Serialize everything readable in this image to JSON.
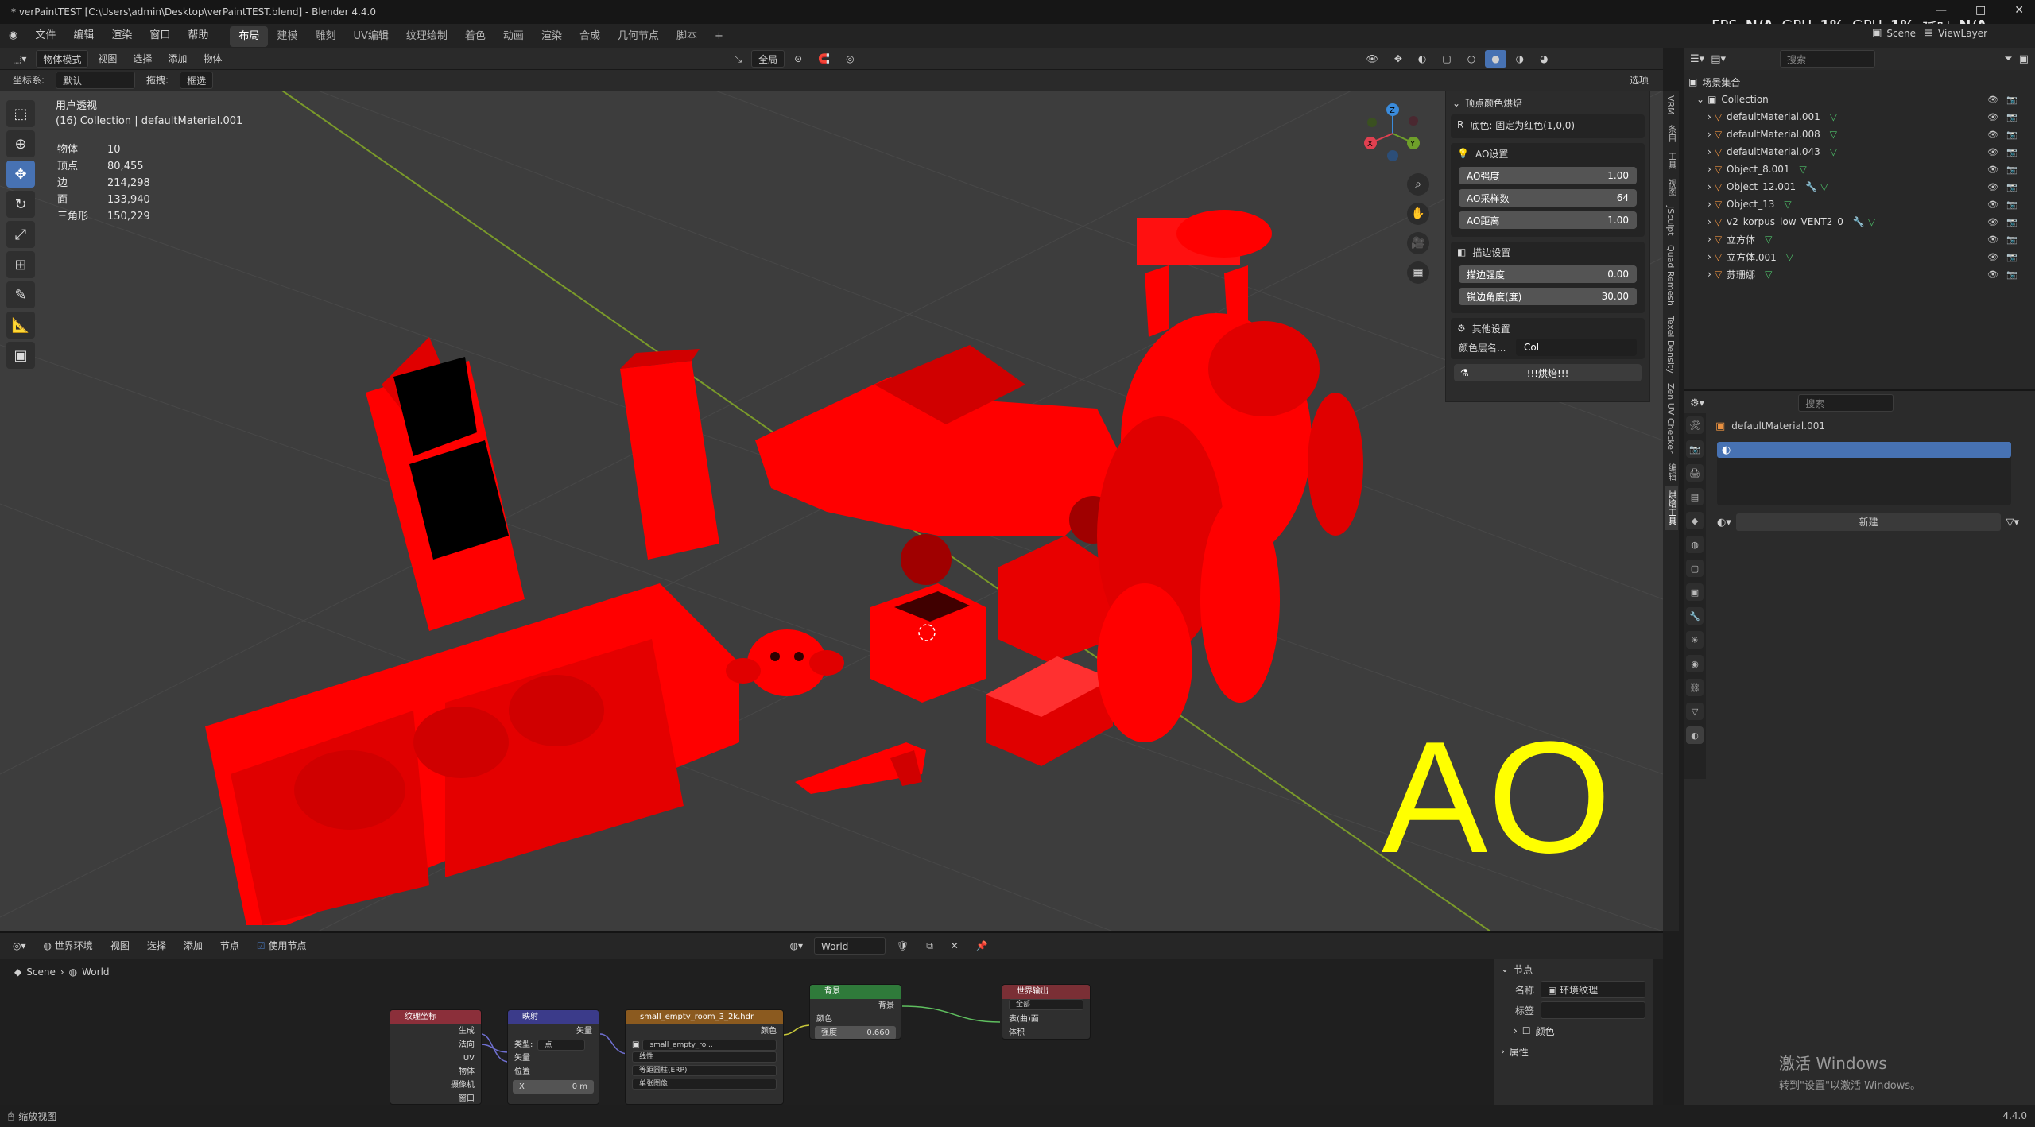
{
  "window": {
    "title": "* verPaintTEST [C:\\Users\\admin\\Desktop\\verPaintTEST.blend] - Blender 4.4.0",
    "perf": {
      "fps_label": "FPS",
      "fps_value": "N/A",
      "gpu_label": "GPU",
      "gpu_value": "1%",
      "gpu2_label": "GPU",
      "gpu2_value": "1%",
      "latency_label": "延时",
      "latency_value": "N/A"
    },
    "scene_label": "Scene",
    "viewlayer_label": "ViewLayer",
    "controls": [
      "—",
      "□",
      "✕"
    ]
  },
  "menubar": {
    "items": [
      "文件",
      "编辑",
      "渲染",
      "窗口",
      "帮助"
    ],
    "workspaces": [
      "布局",
      "建模",
      "雕刻",
      "UV编辑",
      "纹理绘制",
      "着色",
      "动画",
      "渲染",
      "合成",
      "几何节点",
      "脚本"
    ],
    "active_workspace": "布局"
  },
  "viewport_header": {
    "mode": "物体模式",
    "menus": [
      "视图",
      "选择",
      "添加",
      "物体"
    ],
    "transform": "全局",
    "coord_label": "坐标系:",
    "coord_value": "默认",
    "drag_label": "拖拽:",
    "drag_value": "框选",
    "options": "选项"
  },
  "viewport": {
    "view_name": "用户透视",
    "collection_info": "(16) Collection | defaultMaterial.001",
    "stats": [
      {
        "label": "物体",
        "value": "10"
      },
      {
        "label": "顶点",
        "value": "80,455"
      },
      {
        "label": "边",
        "value": "214,298"
      },
      {
        "label": "面",
        "value": "133,940"
      },
      {
        "label": "三角形",
        "value": "150,229"
      }
    ],
    "overlay_text": "AO",
    "overlay_color": "#ffff00",
    "axis_x": "X",
    "axis_y": "Y",
    "axis_z": "Z"
  },
  "npanel": {
    "header": "顶点颜色烘焙",
    "base_label": "底色: 固定为红色(1,0,0)",
    "ao_section": "AO设置",
    "ao_fields": [
      {
        "label": "AO强度",
        "value": "1.00"
      },
      {
        "label": "AO采样数",
        "value": "64"
      },
      {
        "label": "AO距离",
        "value": "1.00"
      }
    ],
    "edge_section": "描边设置",
    "edge_fields": [
      {
        "label": "描边强度",
        "value": "0.00"
      },
      {
        "label": "锐边角度(度)",
        "value": "30.00"
      }
    ],
    "other_section": "其他设置",
    "layer_label": "颜色层名...",
    "layer_value": "Col",
    "bake_button": "!!!烘焙!!!"
  },
  "side_tabs": [
    "VRM",
    "条目",
    "工具",
    "视图",
    "JSculpt",
    "Quad Remesh",
    "Texel Density",
    "Zen UV Checker",
    "编辑",
    "烘焙工具"
  ],
  "outliner": {
    "search_placeholder": "搜索",
    "root": "场景集合",
    "collection": "Collection",
    "objects": [
      "defaultMaterial.001",
      "defaultMaterial.008",
      "defaultMaterial.043",
      "Object_8.001",
      "Object_12.001",
      "Object_13",
      "v2_korpus_low_VENT2_0",
      "立方体",
      "立方体.001",
      "苏珊娜"
    ]
  },
  "properties": {
    "search_placeholder": "搜索",
    "object_name": "defaultMaterial.001",
    "new_button": "新建"
  },
  "node_editor": {
    "editor_type": "世界环境",
    "menus": [
      "视图",
      "选择",
      "添加",
      "节点"
    ],
    "use_nodes_label": "使用节点",
    "world_name": "World",
    "breadcrumb": [
      "Scene",
      "World"
    ],
    "nodes": {
      "texcoord": {
        "title": "纹理坐标",
        "outputs": [
          "生成",
          "法向",
          "UV",
          "物体",
          "摄像机",
          "窗口"
        ]
      },
      "mapping": {
        "title": "映射",
        "vector_out": "矢量",
        "type_label": "类型:",
        "type_value": "点",
        "inputs": [
          "矢量",
          "位置"
        ],
        "x_label": "X",
        "x_value": "0 m"
      },
      "envtex": {
        "title": "small_empty_room_3_2k.hdr",
        "color_out": "颜色",
        "image": "small_empty_ro...",
        "interp": "线性",
        "proj": "等距圆柱(ERP)",
        "src": "单张图像"
      },
      "background": {
        "title": "背景",
        "out": "背景",
        "color_in": "颜色",
        "strength_label": "强度",
        "strength_value": "0.660"
      },
      "output": {
        "title": "世界输出",
        "target": "全部",
        "surface": "表(曲)面",
        "volume": "体积"
      }
    },
    "side": {
      "node_section": "节点",
      "name_label": "名称",
      "name_value": "环境纹理",
      "label_label": "标签",
      "color_label": "颜色",
      "props_section": "属性"
    }
  },
  "statusbar": {
    "left": "缩放视图",
    "version": "4.4.0"
  },
  "watermark": {
    "line1": "激活 Windows",
    "line2": "转到\"设置\"以激活 Windows。"
  }
}
